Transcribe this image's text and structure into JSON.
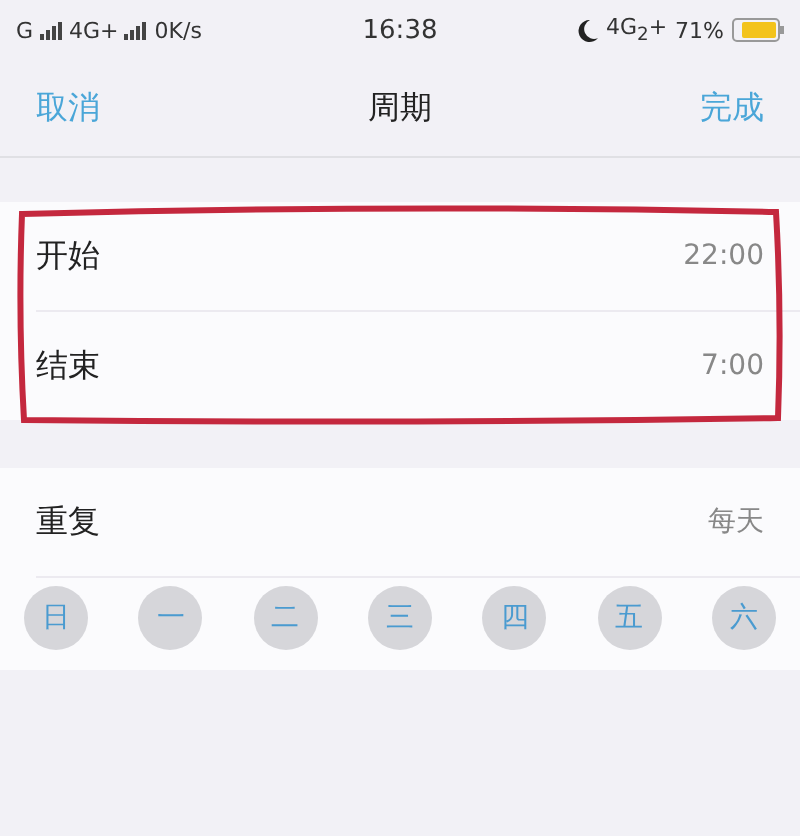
{
  "status_bar": {
    "carrier_1": "G",
    "carrier_2": "4G+",
    "speed": "0K/s",
    "time": "16:38",
    "network": "4G$_{2}$+",
    "battery_percent": "71%"
  },
  "nav": {
    "cancel": "取消",
    "title": "周期",
    "done": "完成"
  },
  "time_rows": [
    {
      "label": "开始",
      "value": "22:00"
    },
    {
      "label": "结束",
      "value": "7:00"
    }
  ],
  "repeat": {
    "label": "重复",
    "value": "每天"
  },
  "days": [
    {
      "label": "日",
      "selected": true
    },
    {
      "label": "一",
      "selected": true
    },
    {
      "label": "二",
      "selected": true
    },
    {
      "label": "三",
      "selected": true
    },
    {
      "label": "四",
      "selected": true
    },
    {
      "label": "五",
      "selected": true
    },
    {
      "label": "六",
      "selected": true
    }
  ]
}
